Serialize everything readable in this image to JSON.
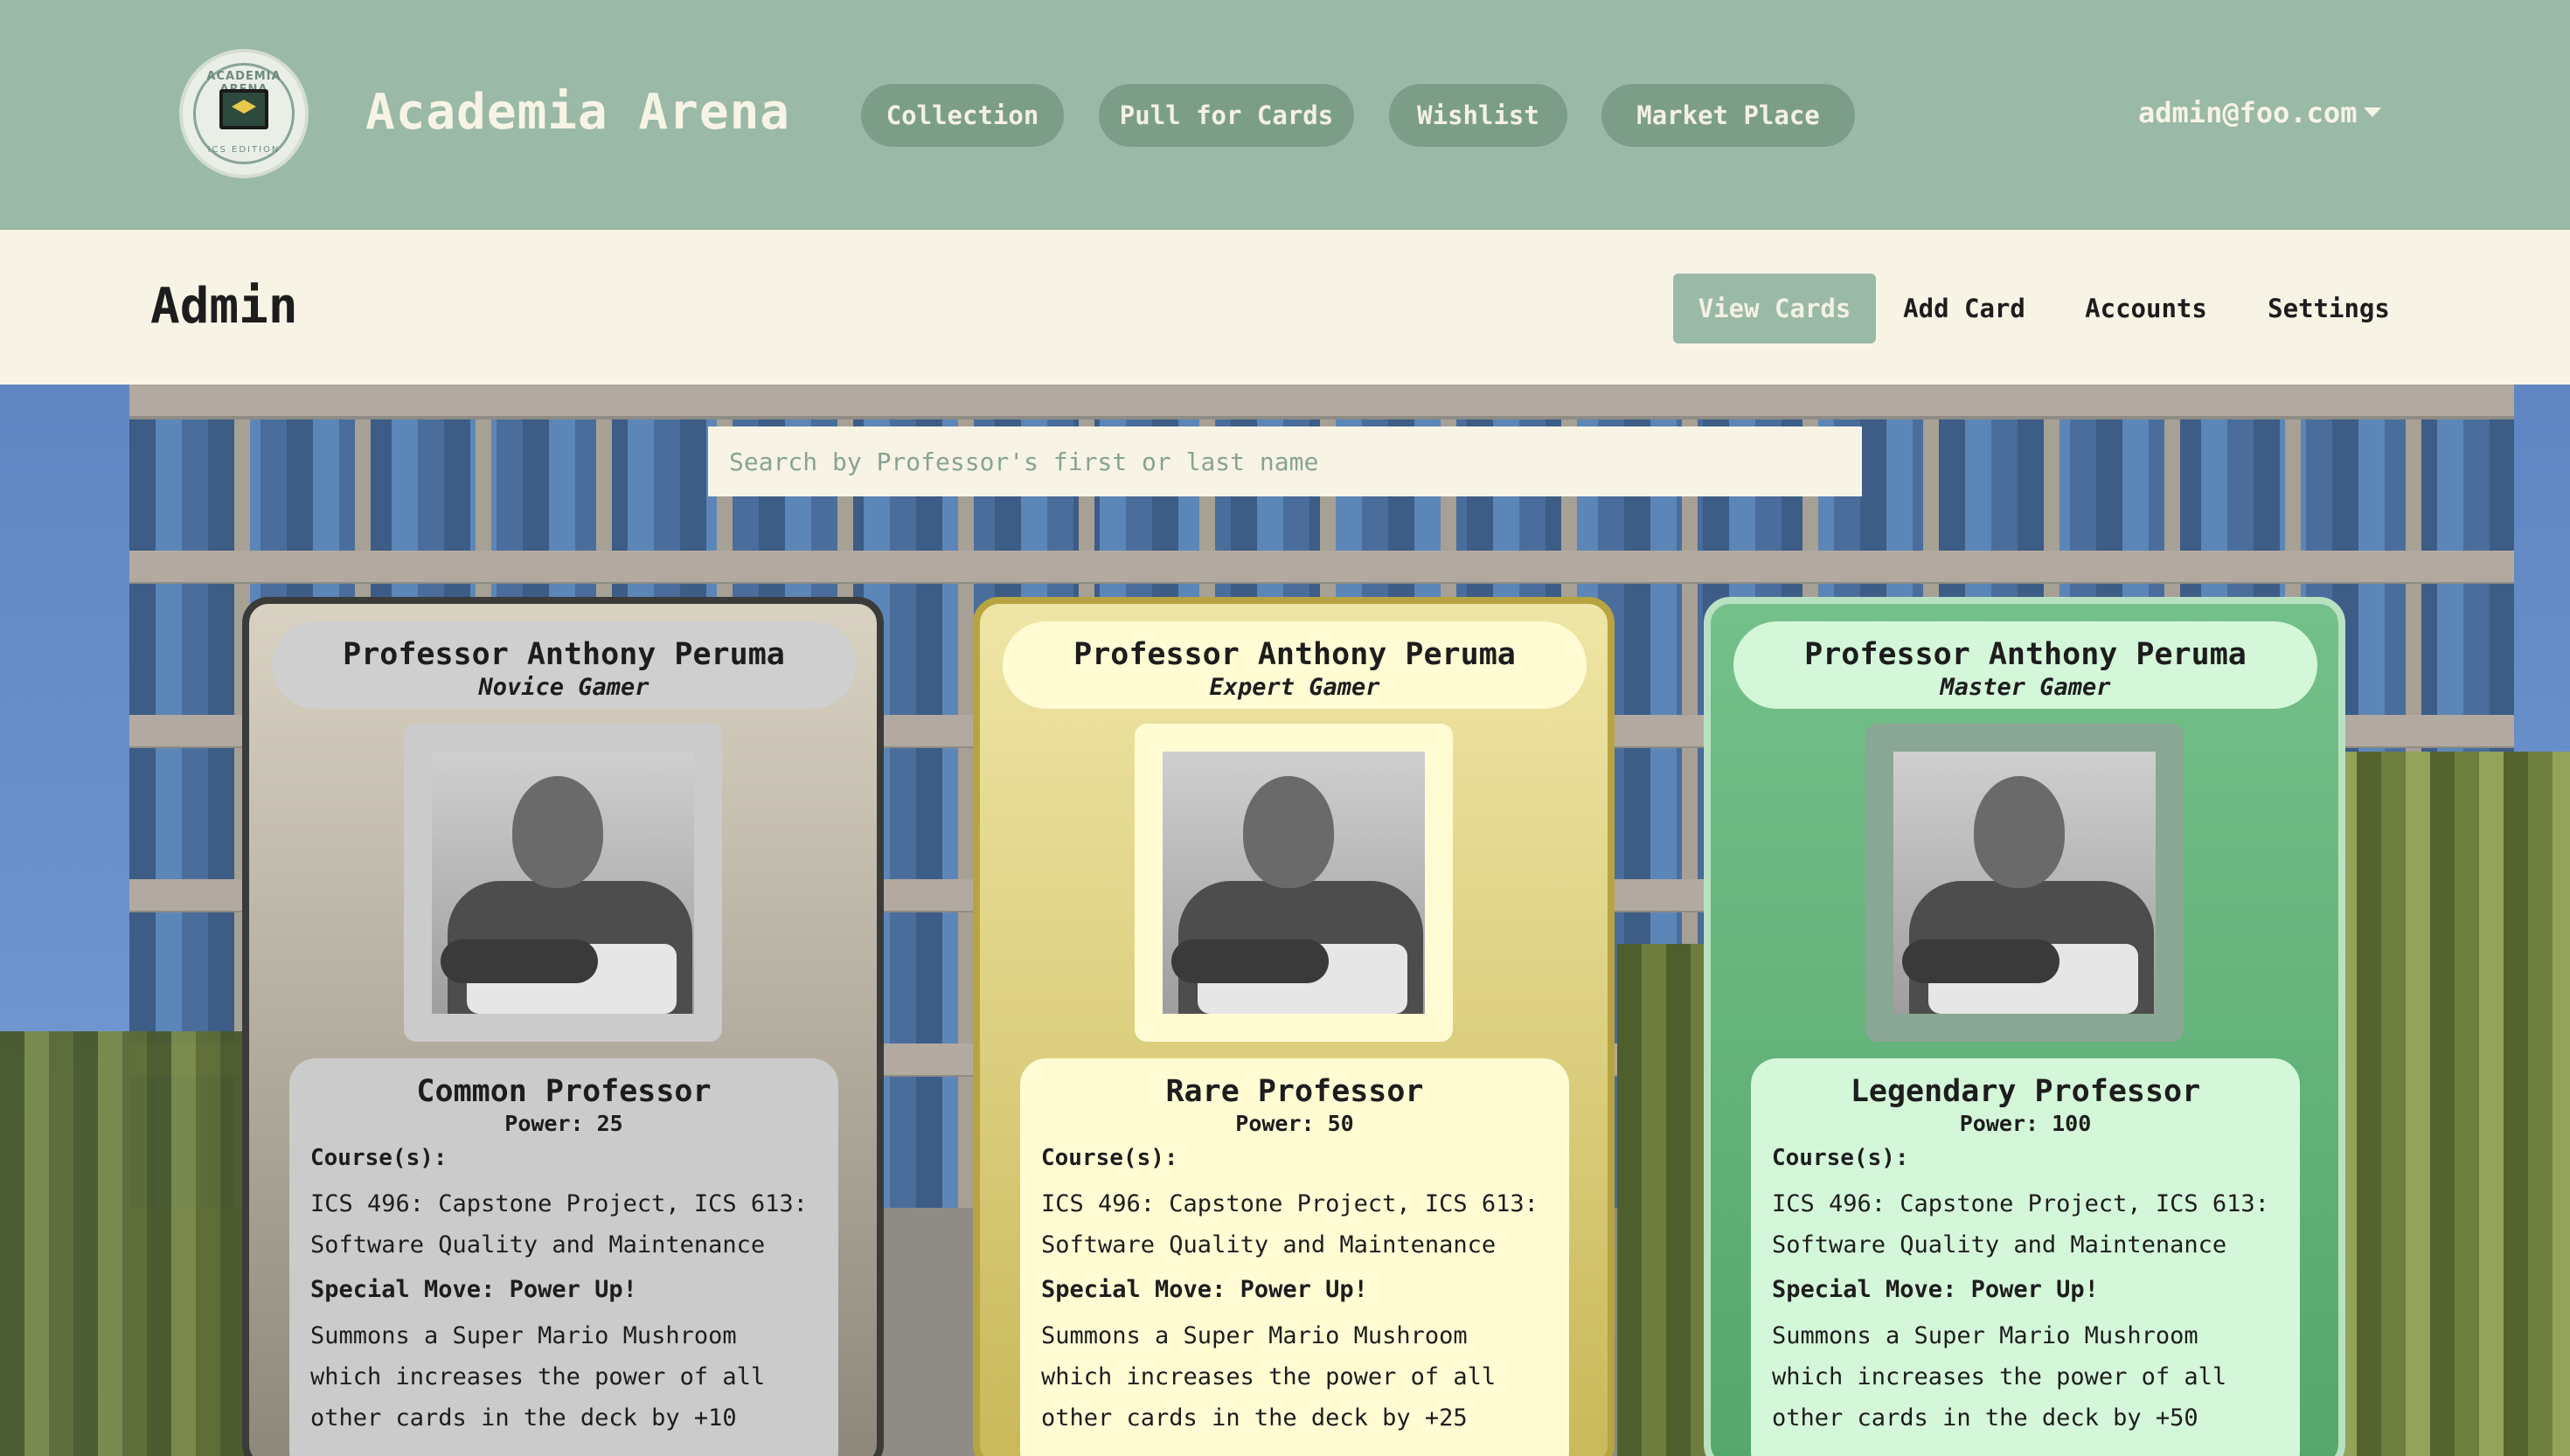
{
  "navbar": {
    "logo_text_top": "ACADEMIA ARENA",
    "logo_text_bottom": "ICS EDITION",
    "brand": "Academia Arena",
    "links": [
      "Collection",
      "Pull for Cards",
      "Wishlist",
      "Market Place"
    ],
    "user": "admin@foo.com"
  },
  "admin": {
    "title": "Admin",
    "tabs": [
      "View Cards",
      "Add Card",
      "Accounts",
      "Settings"
    ],
    "active_tab": "View Cards"
  },
  "search": {
    "placeholder": "Search by Professor's first or last name"
  },
  "cards": [
    {
      "name": "Professor Anthony Peruma",
      "title": "Novice Gamer",
      "rarity": "Common Professor",
      "power": "Power: 25",
      "courses_label": "Course(s):",
      "courses": "ICS 496: Capstone Project, ICS 613: Software Quality and Maintenance",
      "special_move": "Special Move: Power Up!",
      "description": "Summons a Super Mario Mushroom which increases the power of all other cards in the deck by +10"
    },
    {
      "name": "Professor Anthony Peruma",
      "title": "Expert Gamer",
      "rarity": "Rare Professor",
      "power": "Power: 50",
      "courses_label": "Course(s):",
      "courses": "ICS 496: Capstone Project, ICS 613: Software Quality and Maintenance",
      "special_move": "Special Move: Power Up!",
      "description": "Summons a Super Mario Mushroom which increases the power of all other cards in the deck by +25"
    },
    {
      "name": "Professor Anthony Peruma",
      "title": "Master Gamer",
      "rarity": "Legendary Professor",
      "power": "Power: 100",
      "courses_label": "Course(s):",
      "courses": "ICS 496: Capstone Project, ICS 613: Software Quality and Maintenance",
      "special_move": "Special Move: Power Up!",
      "description": "Summons a Super Mario Mushroom which increases the power of all other cards in the deck by +50"
    }
  ],
  "colors": {
    "navbar": "#9ab9a6",
    "pill": "#7c9e89",
    "cream": "#f7f4e6",
    "common": "#cbcbcb",
    "rare": "#fffcd4",
    "legendary": "#d4f7d9"
  }
}
